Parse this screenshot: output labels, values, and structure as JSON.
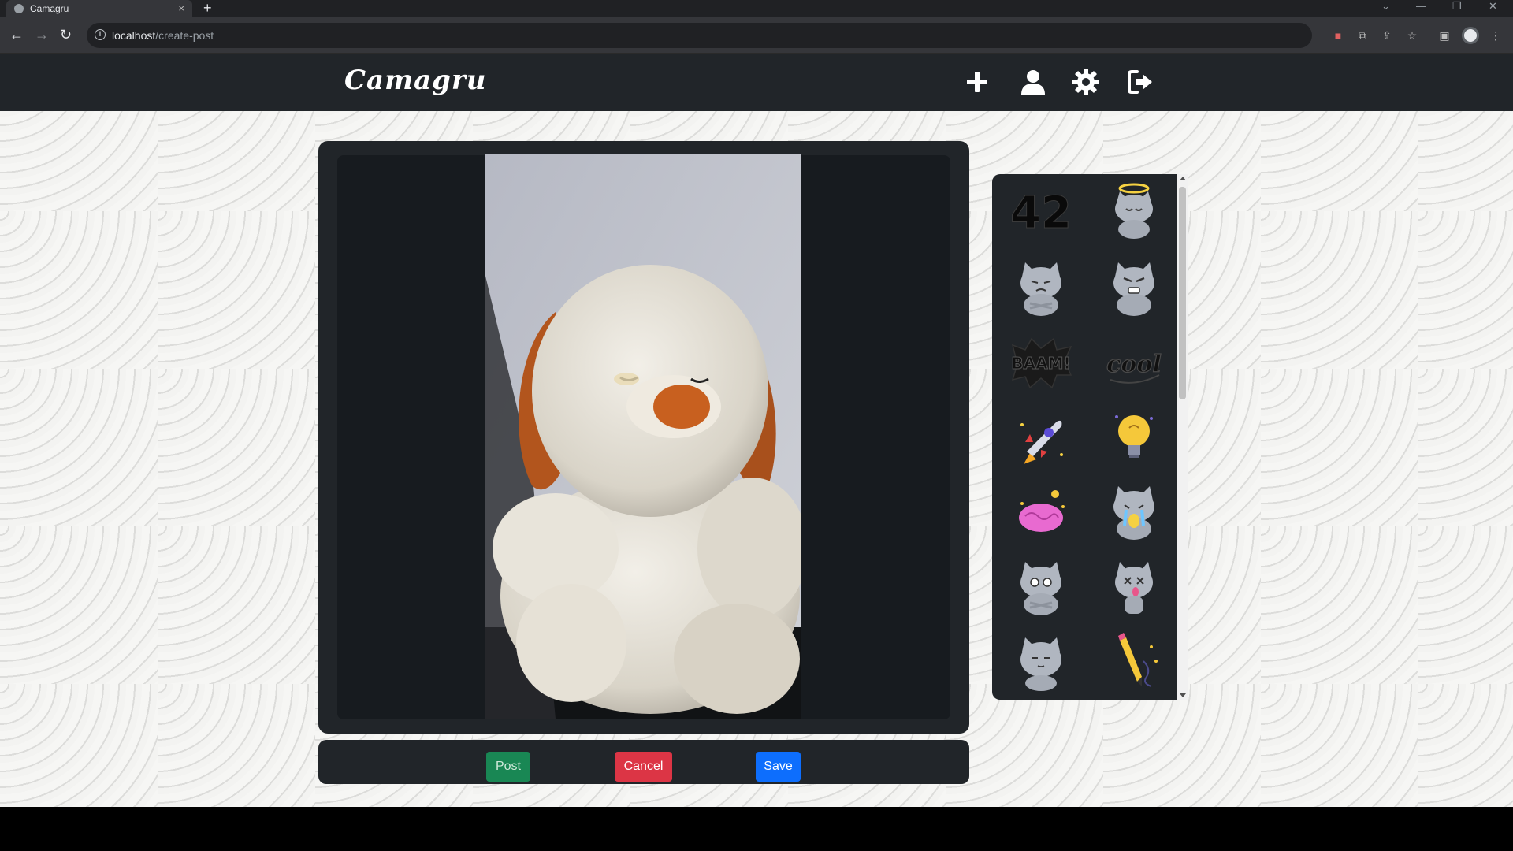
{
  "browser": {
    "tab_title": "Camagru",
    "tab_close": "×",
    "new_tab": "+",
    "url_host": "localhost",
    "url_path": "/create-post"
  },
  "app": {
    "brand": "Camagru",
    "nav_icons": [
      "plus-icon",
      "user-icon",
      "gear-icon",
      "logout-icon"
    ]
  },
  "actions": {
    "post_label": "Post",
    "cancel_label": "Cancel",
    "save_label": "Save"
  },
  "stickers": [
    {
      "name": "sticker-42-logo",
      "label": "42"
    },
    {
      "name": "sticker-angel-cat"
    },
    {
      "name": "sticker-grumpy-cat"
    },
    {
      "name": "sticker-angry-cat"
    },
    {
      "name": "sticker-baam",
      "label": "BAAM!"
    },
    {
      "name": "sticker-cool",
      "label": "cool"
    },
    {
      "name": "sticker-rocket"
    },
    {
      "name": "sticker-lightbulb"
    },
    {
      "name": "sticker-brain"
    },
    {
      "name": "sticker-crying-cat"
    },
    {
      "name": "sticker-teary-cat"
    },
    {
      "name": "sticker-dizzy-cat"
    },
    {
      "name": "sticker-sleepy-cat"
    },
    {
      "name": "sticker-pencil"
    }
  ]
}
